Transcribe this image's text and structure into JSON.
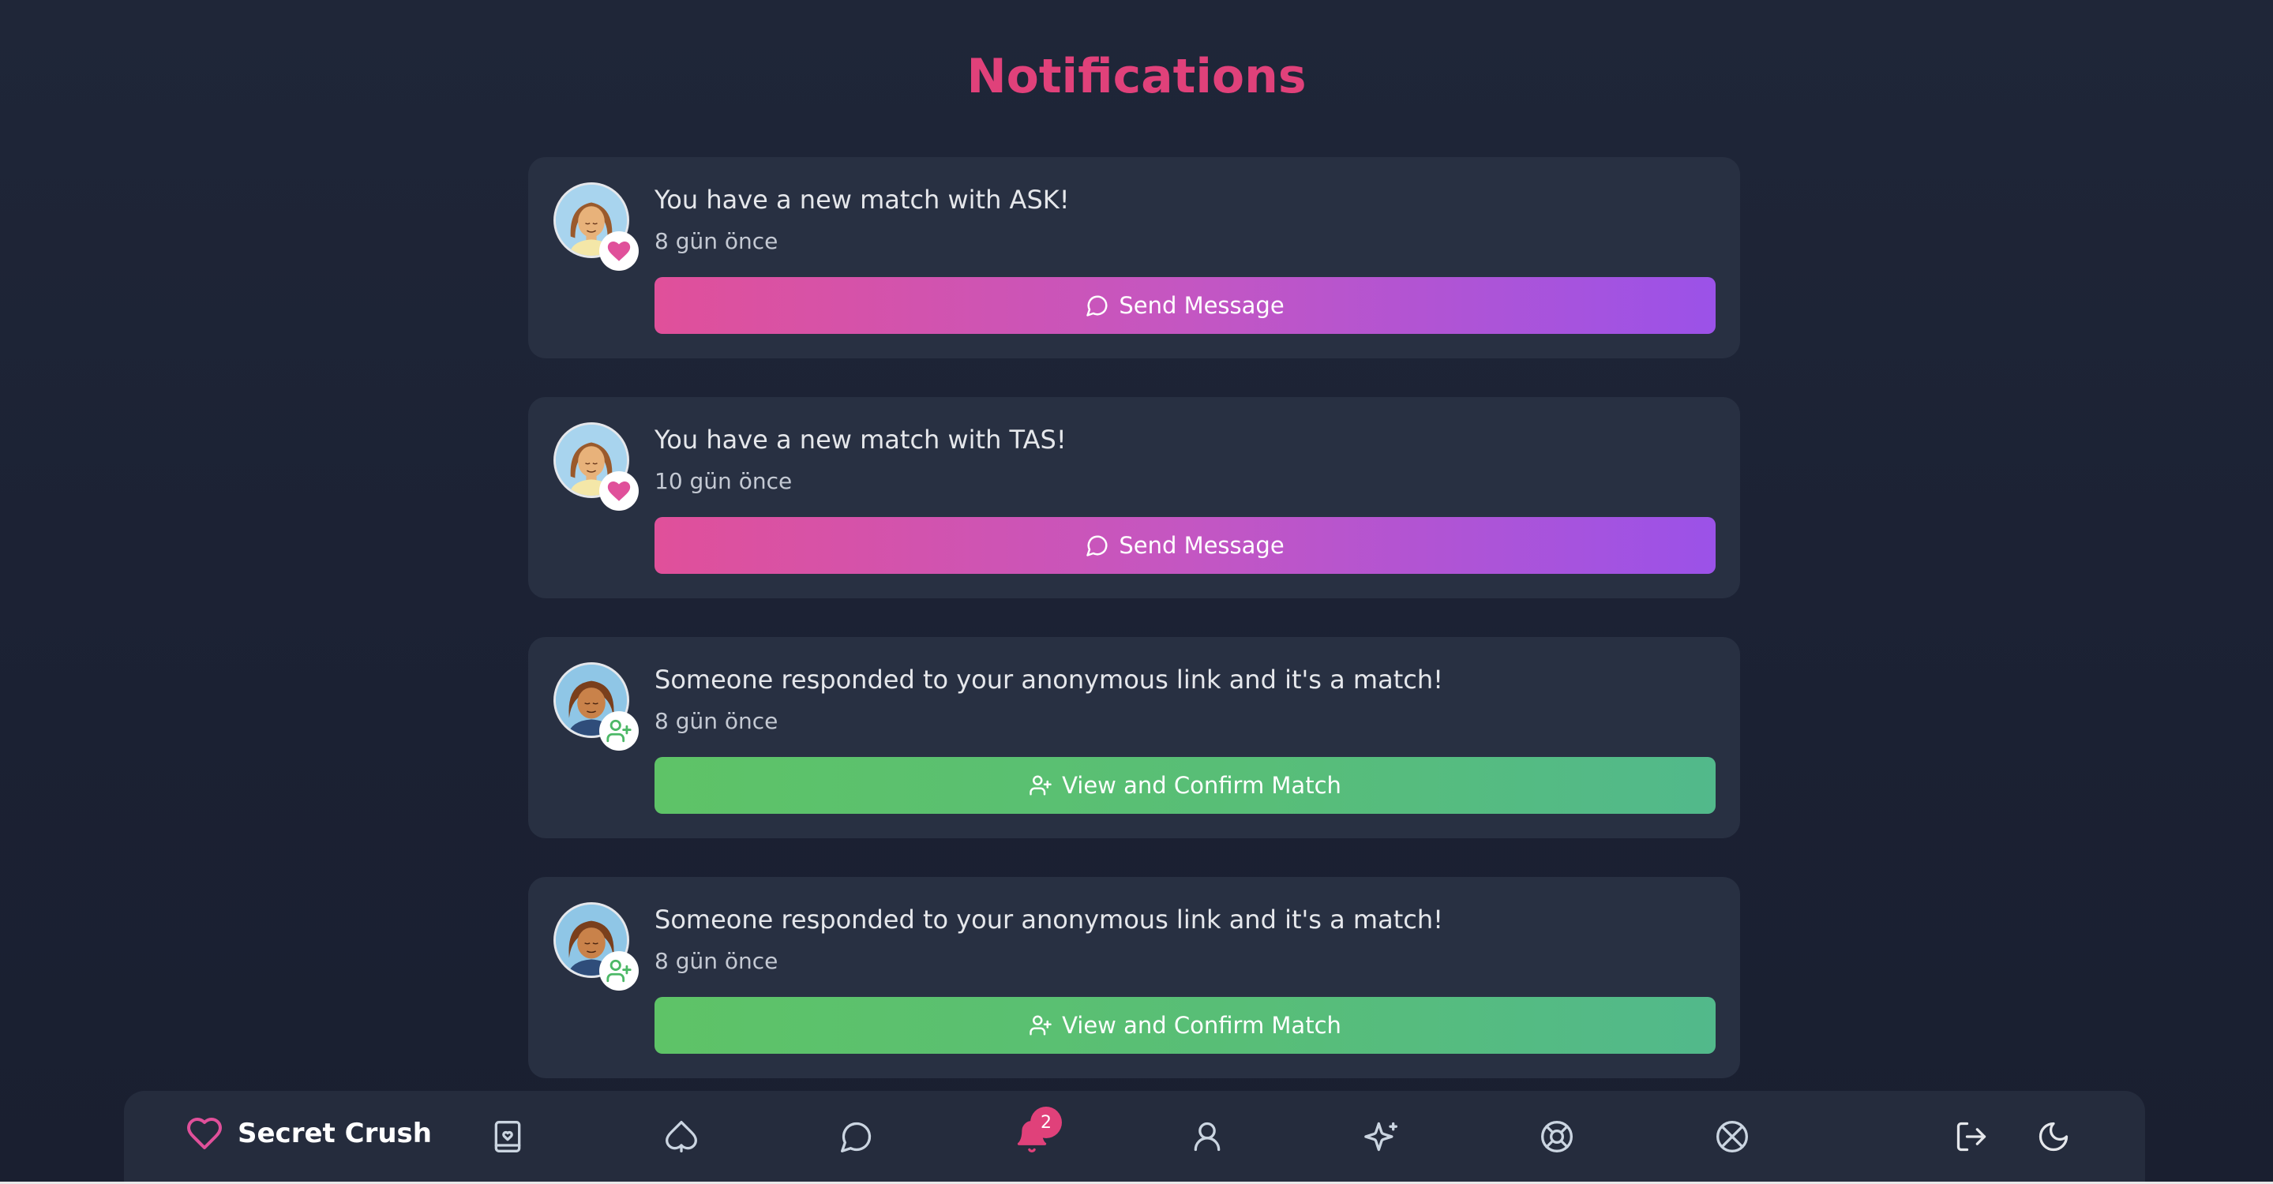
{
  "page": {
    "title": "Notifications"
  },
  "notifications": [
    {
      "message": "You have a new match with ASK!",
      "time": "8 gün önce",
      "action_label": "Send Message",
      "type": "match",
      "badge_icon": "heart-icon",
      "action_icon": "chat-bubble-icon"
    },
    {
      "message": "You have a new match with TAS!",
      "time": "10 gün önce",
      "action_label": "Send Message",
      "type": "match",
      "badge_icon": "heart-icon",
      "action_icon": "chat-bubble-icon"
    },
    {
      "message": "Someone responded to your anonymous link and it's a match!",
      "time": "8 gün önce",
      "action_label": "View and Confirm Match",
      "type": "anonymous-match",
      "badge_icon": "user-plus-icon",
      "action_icon": "user-plus-icon"
    },
    {
      "message": "Someone responded to your anonymous link and it's a match!",
      "time": "8 gün önce",
      "action_label": "View and Confirm Match",
      "type": "anonymous-match",
      "badge_icon": "user-plus-icon",
      "action_icon": "user-plus-icon"
    }
  ],
  "navbar": {
    "brand": "Secret Crush",
    "notification_count": "2",
    "icons": [
      "heart-icon",
      "book-heart-icon",
      "spade-icon",
      "chat-bubble-icon",
      "bell-icon",
      "user-icon",
      "sparkles-icon",
      "lifebuoy-icon",
      "crossed-circle-icon",
      "logout-icon",
      "moon-icon"
    ]
  },
  "colors": {
    "accent": "#e0417a",
    "background": "#1f2638",
    "card": "#283042",
    "pink_gradient": [
      "#e0509a",
      "#9b52e8"
    ],
    "green_gradient": [
      "#5ec367",
      "#52b98b"
    ]
  }
}
